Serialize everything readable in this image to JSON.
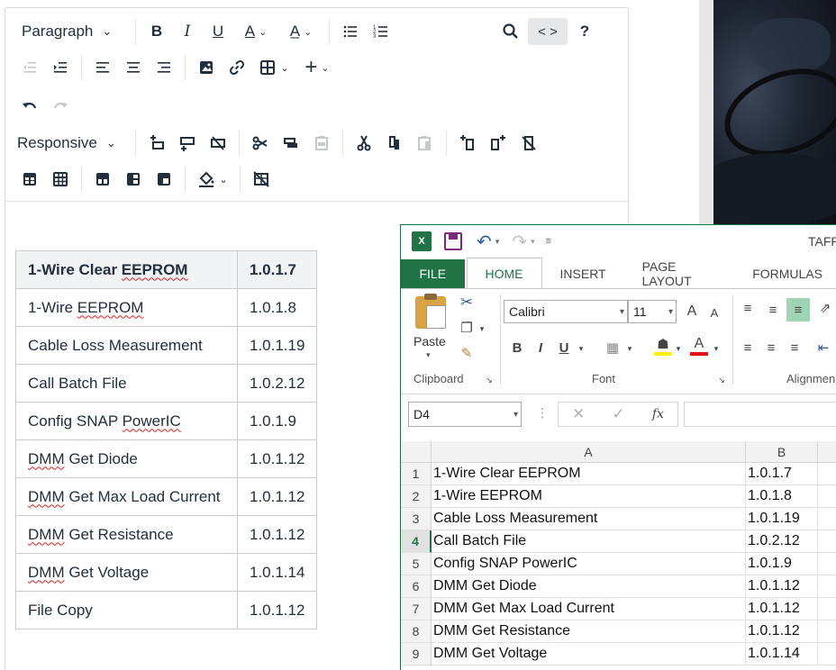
{
  "editor": {
    "toolbar": {
      "block_format": "Paragraph",
      "table_width": "Responsive",
      "source_code_label": "< >",
      "help_label": "?"
    },
    "table": {
      "rows": [
        {
          "name": "1-Wire Clear EEPROM",
          "version": "1.0.1.7"
        },
        {
          "name": "1-Wire EEPROM",
          "version": "1.0.1.8"
        },
        {
          "name": "Cable Loss Measurement",
          "version": "1.0.1.19"
        },
        {
          "name": "Call Batch File",
          "version": "1.0.2.12"
        },
        {
          "name": "Config SNAP PowerIC",
          "version": "1.0.1.9"
        },
        {
          "name": "DMM Get Diode",
          "version": "1.0.1.12"
        },
        {
          "name": "DMM Get Max Load Current",
          "version": "1.0.1.12"
        },
        {
          "name": "DMM Get Resistance",
          "version": "1.0.1.12"
        },
        {
          "name": "DMM Get Voltage",
          "version": "1.0.1.14"
        },
        {
          "name": "File Copy",
          "version": "1.0.1.12"
        }
      ]
    }
  },
  "excel": {
    "title_fragment": "TAFP",
    "tabs": [
      "FILE",
      "HOME",
      "INSERT",
      "PAGE LAYOUT",
      "FORMULAS"
    ],
    "ribbon": {
      "paste_label": "Paste",
      "font_name": "Calibri",
      "font_size": "11",
      "bold": "B",
      "italic": "I",
      "underline": "U",
      "grow_font": "A",
      "shrink_font": "A",
      "group_clipboard": "Clipboard",
      "group_font": "Font",
      "group_alignment": "Alignmen"
    },
    "name_box": "D4",
    "fx_label": "fx",
    "columns": [
      "A",
      "B"
    ],
    "selected_row": 4,
    "rows": [
      {
        "num": "1",
        "a": "1-Wire Clear EEPROM",
        "b": "1.0.1.7"
      },
      {
        "num": "2",
        "a": "1-Wire EEPROM",
        "b": "1.0.1.8"
      },
      {
        "num": "3",
        "a": "Cable Loss Measurement",
        "b": "1.0.1.19"
      },
      {
        "num": "4",
        "a": "Call Batch File",
        "b": "1.0.2.12"
      },
      {
        "num": "5",
        "a": "Config SNAP PowerIC",
        "b": "1.0.1.9"
      },
      {
        "num": "6",
        "a": "DMM Get Diode",
        "b": "1.0.1.12"
      },
      {
        "num": "7",
        "a": "DMM Get Max Load Current",
        "b": "1.0.1.12"
      },
      {
        "num": "8",
        "a": "DMM Get Resistance",
        "b": "1.0.1.12"
      },
      {
        "num": "9",
        "a": "DMM Get Voltage",
        "b": "1.0.1.14"
      }
    ]
  }
}
